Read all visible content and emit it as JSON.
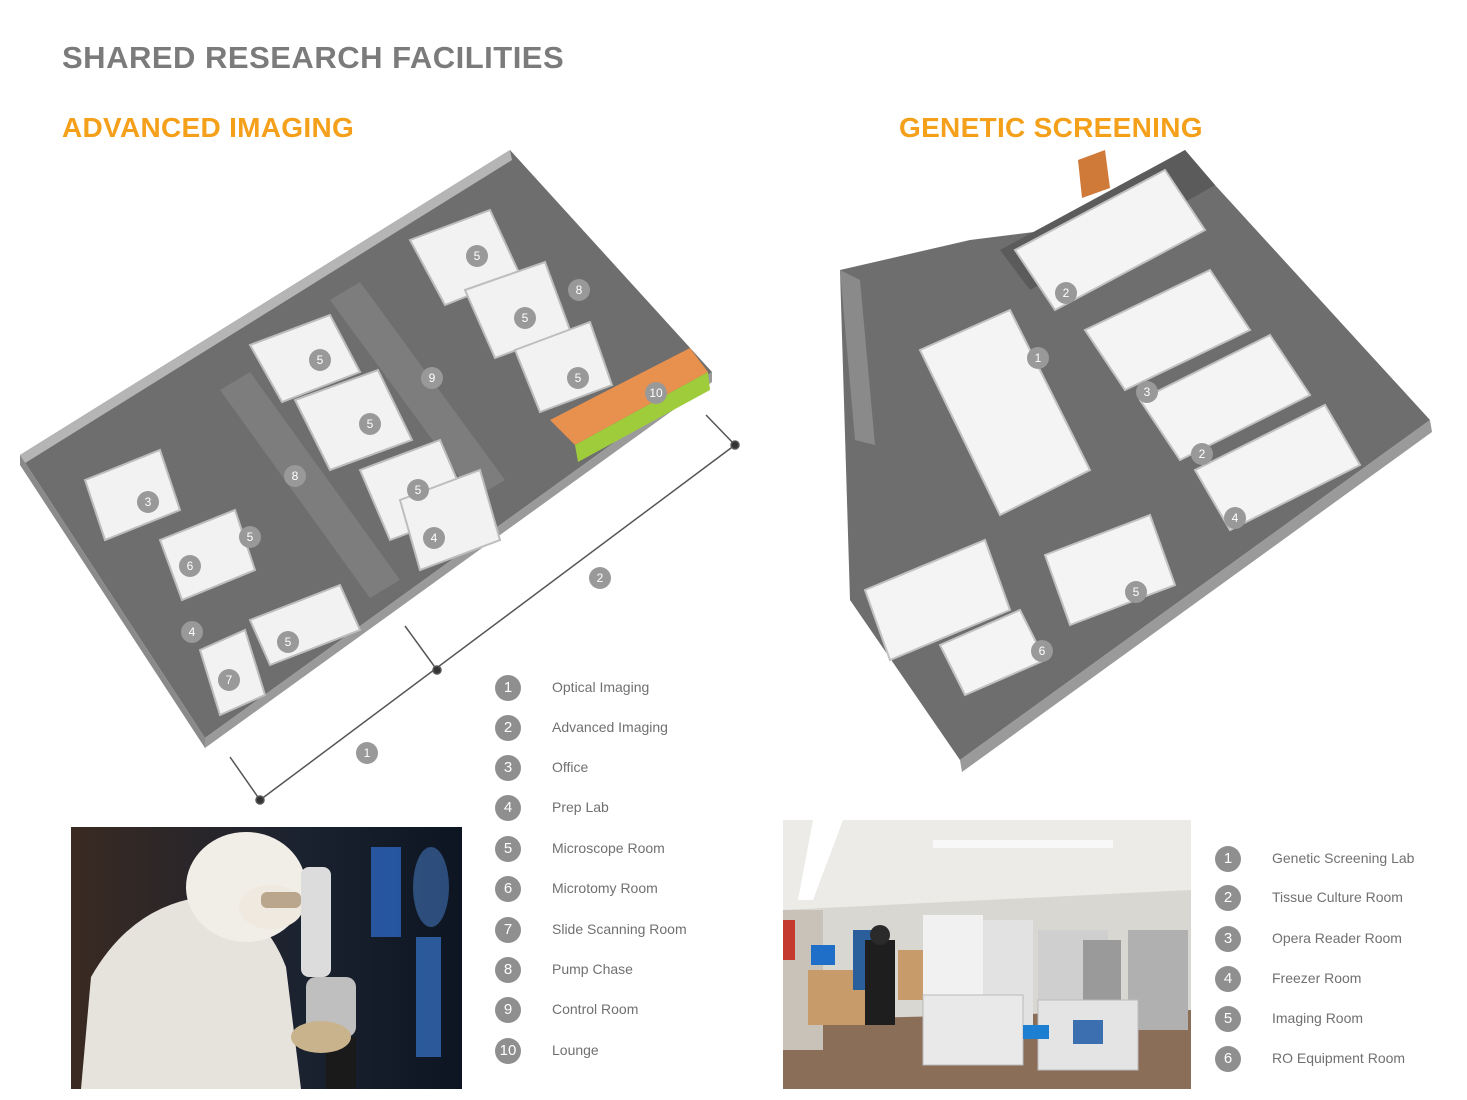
{
  "page_title": "SHARED RESEARCH FACILITIES",
  "sections": {
    "advanced_imaging": {
      "title": "ADVANCED IMAGING",
      "plan_room_numbers": [
        "1",
        "2",
        "3",
        "4",
        "5",
        "6",
        "7",
        "8",
        "9",
        "10"
      ],
      "legend": [
        {
          "num": "1",
          "label": "Optical Imaging"
        },
        {
          "num": "2",
          "label": "Advanced Imaging"
        },
        {
          "num": "3",
          "label": "Office"
        },
        {
          "num": "4",
          "label": "Prep Lab"
        },
        {
          "num": "5",
          "label": "Microscope Room"
        },
        {
          "num": "6",
          "label": "Microtomy Room"
        },
        {
          "num": "7",
          "label": "Slide Scanning Room"
        },
        {
          "num": "8",
          "label": "Pump Chase"
        },
        {
          "num": "9",
          "label": "Control Room"
        },
        {
          "num": "10",
          "label": "Lounge"
        }
      ]
    },
    "genetic_screening": {
      "title": "GENETIC SCREENING",
      "plan_room_numbers": [
        "1",
        "2",
        "3",
        "4",
        "5",
        "6"
      ],
      "legend": [
        {
          "num": "1",
          "label": "Genetic Screening Lab"
        },
        {
          "num": "2",
          "label": "Tissue Culture Room"
        },
        {
          "num": "3",
          "label": "Opera Reader Room"
        },
        {
          "num": "4",
          "label": "Freezer Room"
        },
        {
          "num": "5",
          "label": "Imaging Room"
        },
        {
          "num": "6",
          "label": "RO Equipment Room"
        }
      ]
    }
  },
  "colors": {
    "title_gray": "#7b7b7b",
    "section_orange": "#f5a01a",
    "badge_gray": "#8f8f8f",
    "floor_gray": "#6e6e6e",
    "wall_gray": "#a9a9a9",
    "lounge_orange": "#e8914f",
    "accent_green": "#9fcc3b"
  }
}
